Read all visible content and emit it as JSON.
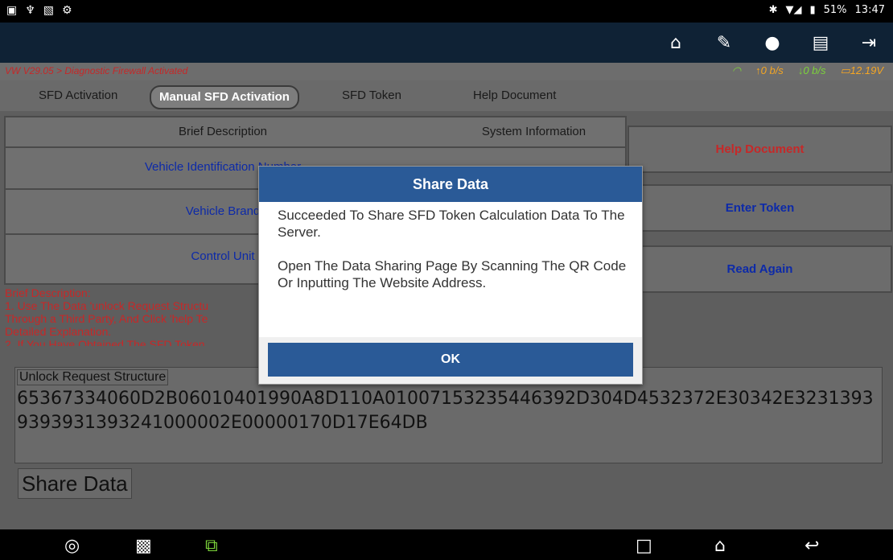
{
  "statusbar": {
    "left_icons": [
      "screenshot-icon",
      "usb-icon",
      "image-icon",
      "settings-icon"
    ],
    "battery": "51%",
    "time": "13:47"
  },
  "topbar": {
    "icons": [
      "home-icon",
      "edit-icon",
      "chat-icon",
      "print-icon",
      "exit-icon"
    ]
  },
  "breadcrumb": {
    "text": "VW V29.05 > Diagnostic Firewall Activated",
    "up_rate": "0 b/s",
    "down_rate": "0 b/s",
    "voltage": "12.19V"
  },
  "tabs": [
    {
      "label": "SFD Activation"
    },
    {
      "label": "Manual SFD Activation"
    },
    {
      "label": "SFD Token"
    },
    {
      "label": "Help Document"
    }
  ],
  "table": {
    "headers": [
      "Brief Description",
      "System Information"
    ],
    "rows": [
      {
        "label": "Vehicle Identification Number",
        "value": ""
      },
      {
        "label": "Vehicle Brand",
        "value": ""
      },
      {
        "label": "Control Unit",
        "value": ""
      }
    ]
  },
  "right_buttons": [
    {
      "label": "Help Document"
    },
    {
      "label": "Enter Token"
    },
    {
      "label": "Read Again"
    }
  ],
  "description": {
    "title": "Brief Description:",
    "line1": "1. Use The Data 'unlock Request Structu",
    "line2": "Through a Third Party, And Click 'help Te",
    "line3": "Detailed Explanation.",
    "line4": "2. If You Have Obtained The SFD Token,"
  },
  "unlock": {
    "title": "Unlock Request Structure",
    "hex": "65367334060D2B06010401990A8D110A01007153235446392D304D4532372E30342E32313939393931393241000002E00000170D17E64DB"
  },
  "share_button": "Share Data",
  "modal": {
    "title": "Share Data",
    "message1": "Succeeded To Share SFD Token Calculation Data To The Server.",
    "message2": "Open The Data Sharing Page By Scanning The QR Code Or Inputting The Website Address.",
    "ok": "OK"
  },
  "navbar": {
    "icons": [
      "browser-icon",
      "gallery-icon",
      "vci-icon",
      "recent-apps-icon",
      "home-nav-icon",
      "back-icon"
    ]
  }
}
